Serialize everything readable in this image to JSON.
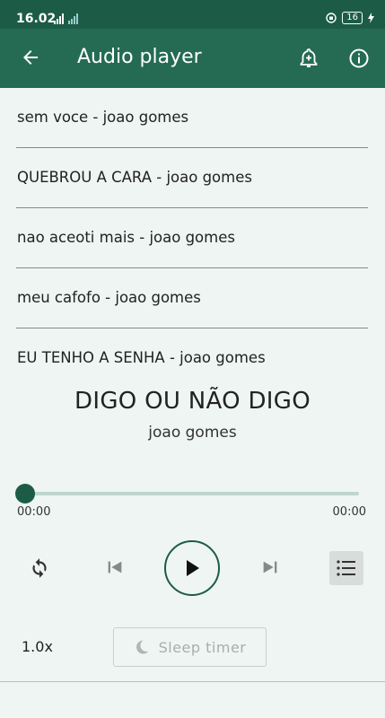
{
  "status_bar": {
    "time": "16.02",
    "signal": "..ıl ..ıl",
    "battery": "16"
  },
  "header": {
    "title": "Audio player"
  },
  "playlist": [
    {
      "label": "sem voce - joao gomes"
    },
    {
      "label": "QUEBROU A CARA - joao gomes"
    },
    {
      "label": "nao aceoti mais - joao gomes"
    },
    {
      "label": "meu cafofo - joao gomes"
    },
    {
      "label": "EU TENHO A SENHA - joao gomes"
    }
  ],
  "now_playing": {
    "title": "DIGO OU NÃO DIGO",
    "artist": "joao gomes",
    "current_time": "00:00",
    "total_time": "00:00",
    "progress": 0
  },
  "controls": {
    "speed": "1.0x",
    "sleep_timer_label": "Sleep timer"
  },
  "colors": {
    "app_bar": "#256b54",
    "status_bar": "#1c5c46",
    "background": "#eef5f2",
    "accent": "#1c5c46"
  },
  "icons": {
    "back": "arrow-left-icon",
    "bell": "bell-plus-icon",
    "info": "info-icon",
    "repeat": "repeat-icon",
    "previous": "skip-previous-icon",
    "play": "play-icon",
    "next": "skip-next-icon",
    "queue": "list-icon",
    "sleep": "moon-icon"
  }
}
